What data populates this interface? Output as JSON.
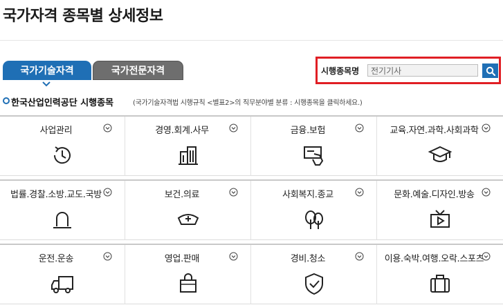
{
  "header": {
    "title": "국가자격 종목별 상세정보"
  },
  "tabs": [
    {
      "label": "국가기술자격",
      "active": true
    },
    {
      "label": "국가전문자격",
      "active": false
    }
  ],
  "search": {
    "label": "시행종목명",
    "value": "전기기사",
    "placeholder": ""
  },
  "section": {
    "title": "한국산업인력공단 시행종목",
    "note": "(국가기술자격법 시행규칙 <별표2>의 직무분야별 분류 : 시행종목을 클릭하세요.)"
  },
  "colors": {
    "accent": "#1f6fb5",
    "highlight": "#e01e24",
    "inactive_tab": "#6e6e6e"
  },
  "categories": [
    {
      "label": "사업관리",
      "icon": "timer-icon"
    },
    {
      "label": "경영.회계.사무",
      "icon": "office-building-icon"
    },
    {
      "label": "금융.보험",
      "icon": "card-payment-icon"
    },
    {
      "label": "교육.자연.과학.사회과학",
      "icon": "graduation-cap-icon"
    },
    {
      "label": "법률.경찰.소방.교도.국방",
      "icon": "siren-icon"
    },
    {
      "label": "보건.의료",
      "icon": "nurse-cap-icon"
    },
    {
      "label": "사회복지.종교",
      "icon": "trees-icon"
    },
    {
      "label": "문화.예술.디자인.방송",
      "icon": "tv-icon"
    },
    {
      "label": "운전.운송",
      "icon": "truck-icon"
    },
    {
      "label": "영업.판매",
      "icon": "shopping-bag-icon"
    },
    {
      "label": "경비.청소",
      "icon": "shield-check-icon"
    },
    {
      "label": "이용.숙박.여행.오락.스포츠",
      "icon": "suitcase-icon"
    }
  ]
}
